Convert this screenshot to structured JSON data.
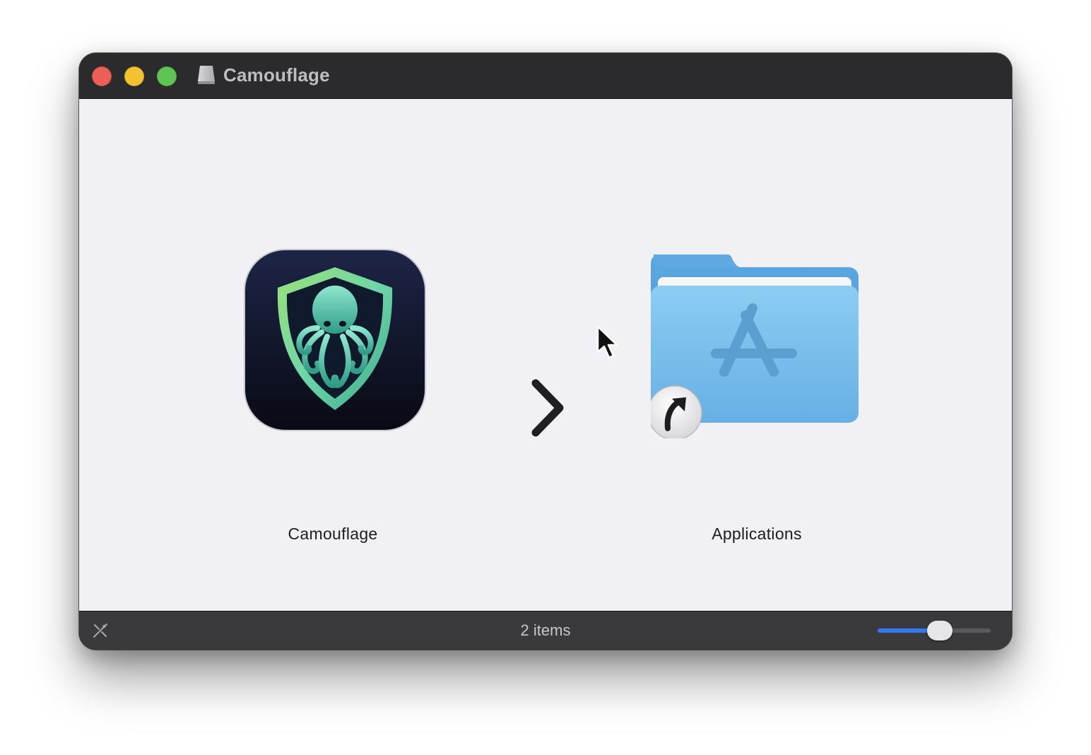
{
  "window": {
    "title": "Camouflage"
  },
  "items": [
    {
      "label": "Camouflage",
      "icon": "camouflage-app-icon"
    },
    {
      "label": "Applications",
      "icon": "applications-folder-alias-icon"
    }
  ],
  "statusbar": {
    "item_count": "2 items",
    "icon_size_slider_value": 0.55
  },
  "colors": {
    "close": "#ec5f57",
    "minimize": "#f3c231",
    "maximize": "#5fc552",
    "accent": "#3478f6",
    "folder": "#6cb6e8"
  }
}
